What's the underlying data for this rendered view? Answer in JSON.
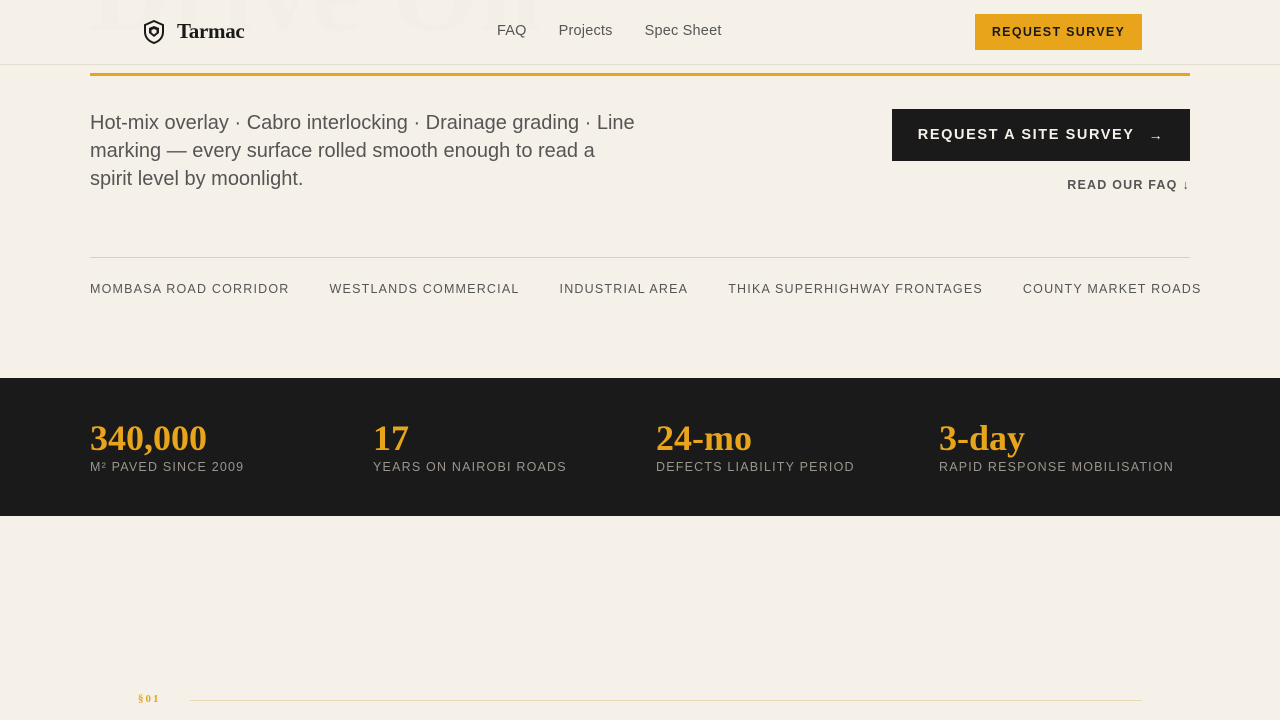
{
  "hero": {
    "ghost_text": "Drive On"
  },
  "brand": {
    "name": "Tarmac",
    "icon": "shield-logo-icon"
  },
  "nav": {
    "items": [
      {
        "label": "FAQ"
      },
      {
        "label": "Projects"
      },
      {
        "label": "Spec Sheet"
      }
    ]
  },
  "header": {
    "cta_label": "REQUEST SURVEY"
  },
  "intro": {
    "text": "Hot-mix overlay · Cabro interlocking · Drainage grading · Line marking — every surface rolled smooth enough to read a spirit level by moonlight."
  },
  "cta": {
    "label": "REQUEST A SITE SURVEY",
    "arrow": "→",
    "faq_label": "READ OUR FAQ",
    "faq_arrow": "↓"
  },
  "areas": [
    "MOMBASA ROAD CORRIDOR",
    "WESTLANDS COMMERCIAL",
    "INDUSTRIAL AREA",
    "THIKA SUPERHIGHWAY FRONTAGES",
    "COUNTY MARKET ROADS"
  ],
  "stats": [
    {
      "value": "340,000",
      "label": "M² PAVED SINCE 2009"
    },
    {
      "value": "17",
      "label": "YEARS ON NAIROBI ROADS"
    },
    {
      "value": "24-mo",
      "label": "DEFECTS LIABILITY PERIOD"
    },
    {
      "value": "3-day",
      "label": "RAPID RESPONSE MOBILISATION"
    }
  ],
  "section": {
    "marker": "§01"
  },
  "colors": {
    "background": "#f5f0e8",
    "accent": "#e8a51c",
    "dark": "#1a1a1a",
    "muted_text": "#555555"
  }
}
